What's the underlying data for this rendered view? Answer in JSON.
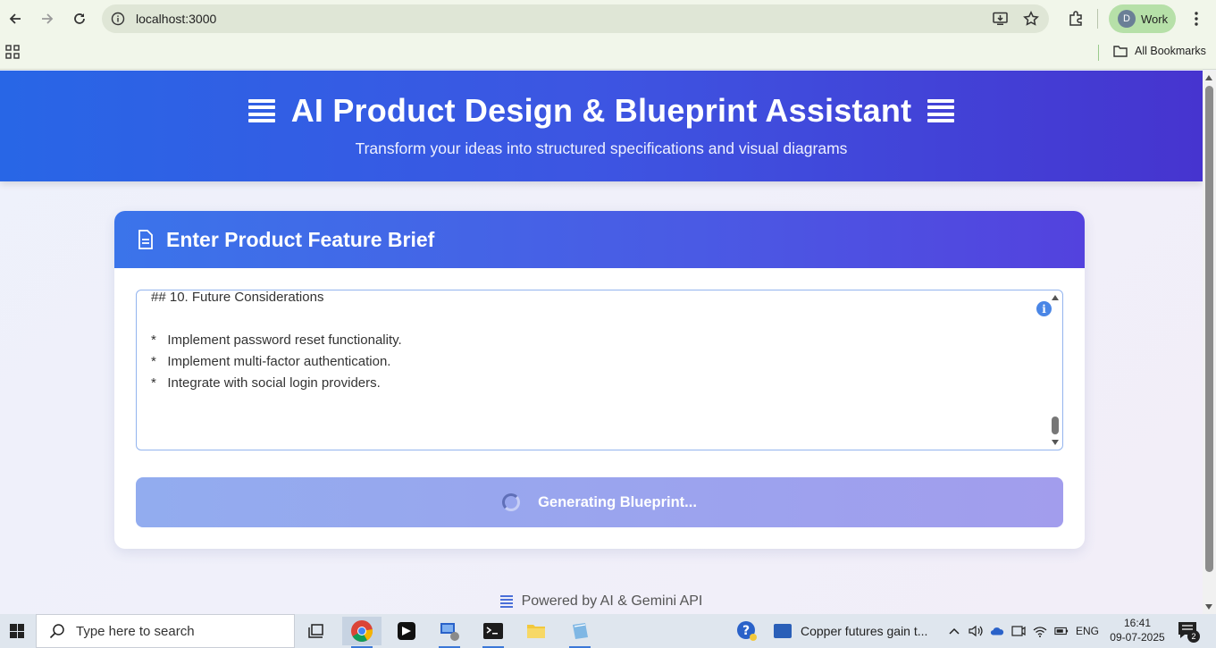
{
  "browser": {
    "url": "localhost:3000",
    "profile_initial": "D",
    "profile_label": "Work",
    "bookmarks_label": "All Bookmarks"
  },
  "header": {
    "title": "AI Product Design & Blueprint Assistant",
    "subtitle": "Transform your ideas into structured specifications and visual diagrams"
  },
  "card": {
    "title": "Enter Product Feature Brief",
    "textarea_content": "## 10. Future Considerations\n\n*   Implement password reset functionality.\n*   Implement multi-factor authentication.\n*   Integrate with social login providers.",
    "info_glyph": "i",
    "button_label": "Generating Blueprint..."
  },
  "footer": {
    "text": "Powered by AI & Gemini API"
  },
  "taskbar": {
    "search_placeholder": "Type here to search",
    "news_text": "Copper futures gain t...",
    "language": "ENG",
    "time": "16:41",
    "date": "09-07-2025",
    "notification_count": "2"
  },
  "colors": {
    "hero_gradient_start": "#2866e6",
    "hero_gradient_end": "#4634cf",
    "button_gradient_start": "#92acef",
    "button_gradient_end": "#a29ded",
    "textarea_border": "#93b4ee"
  }
}
